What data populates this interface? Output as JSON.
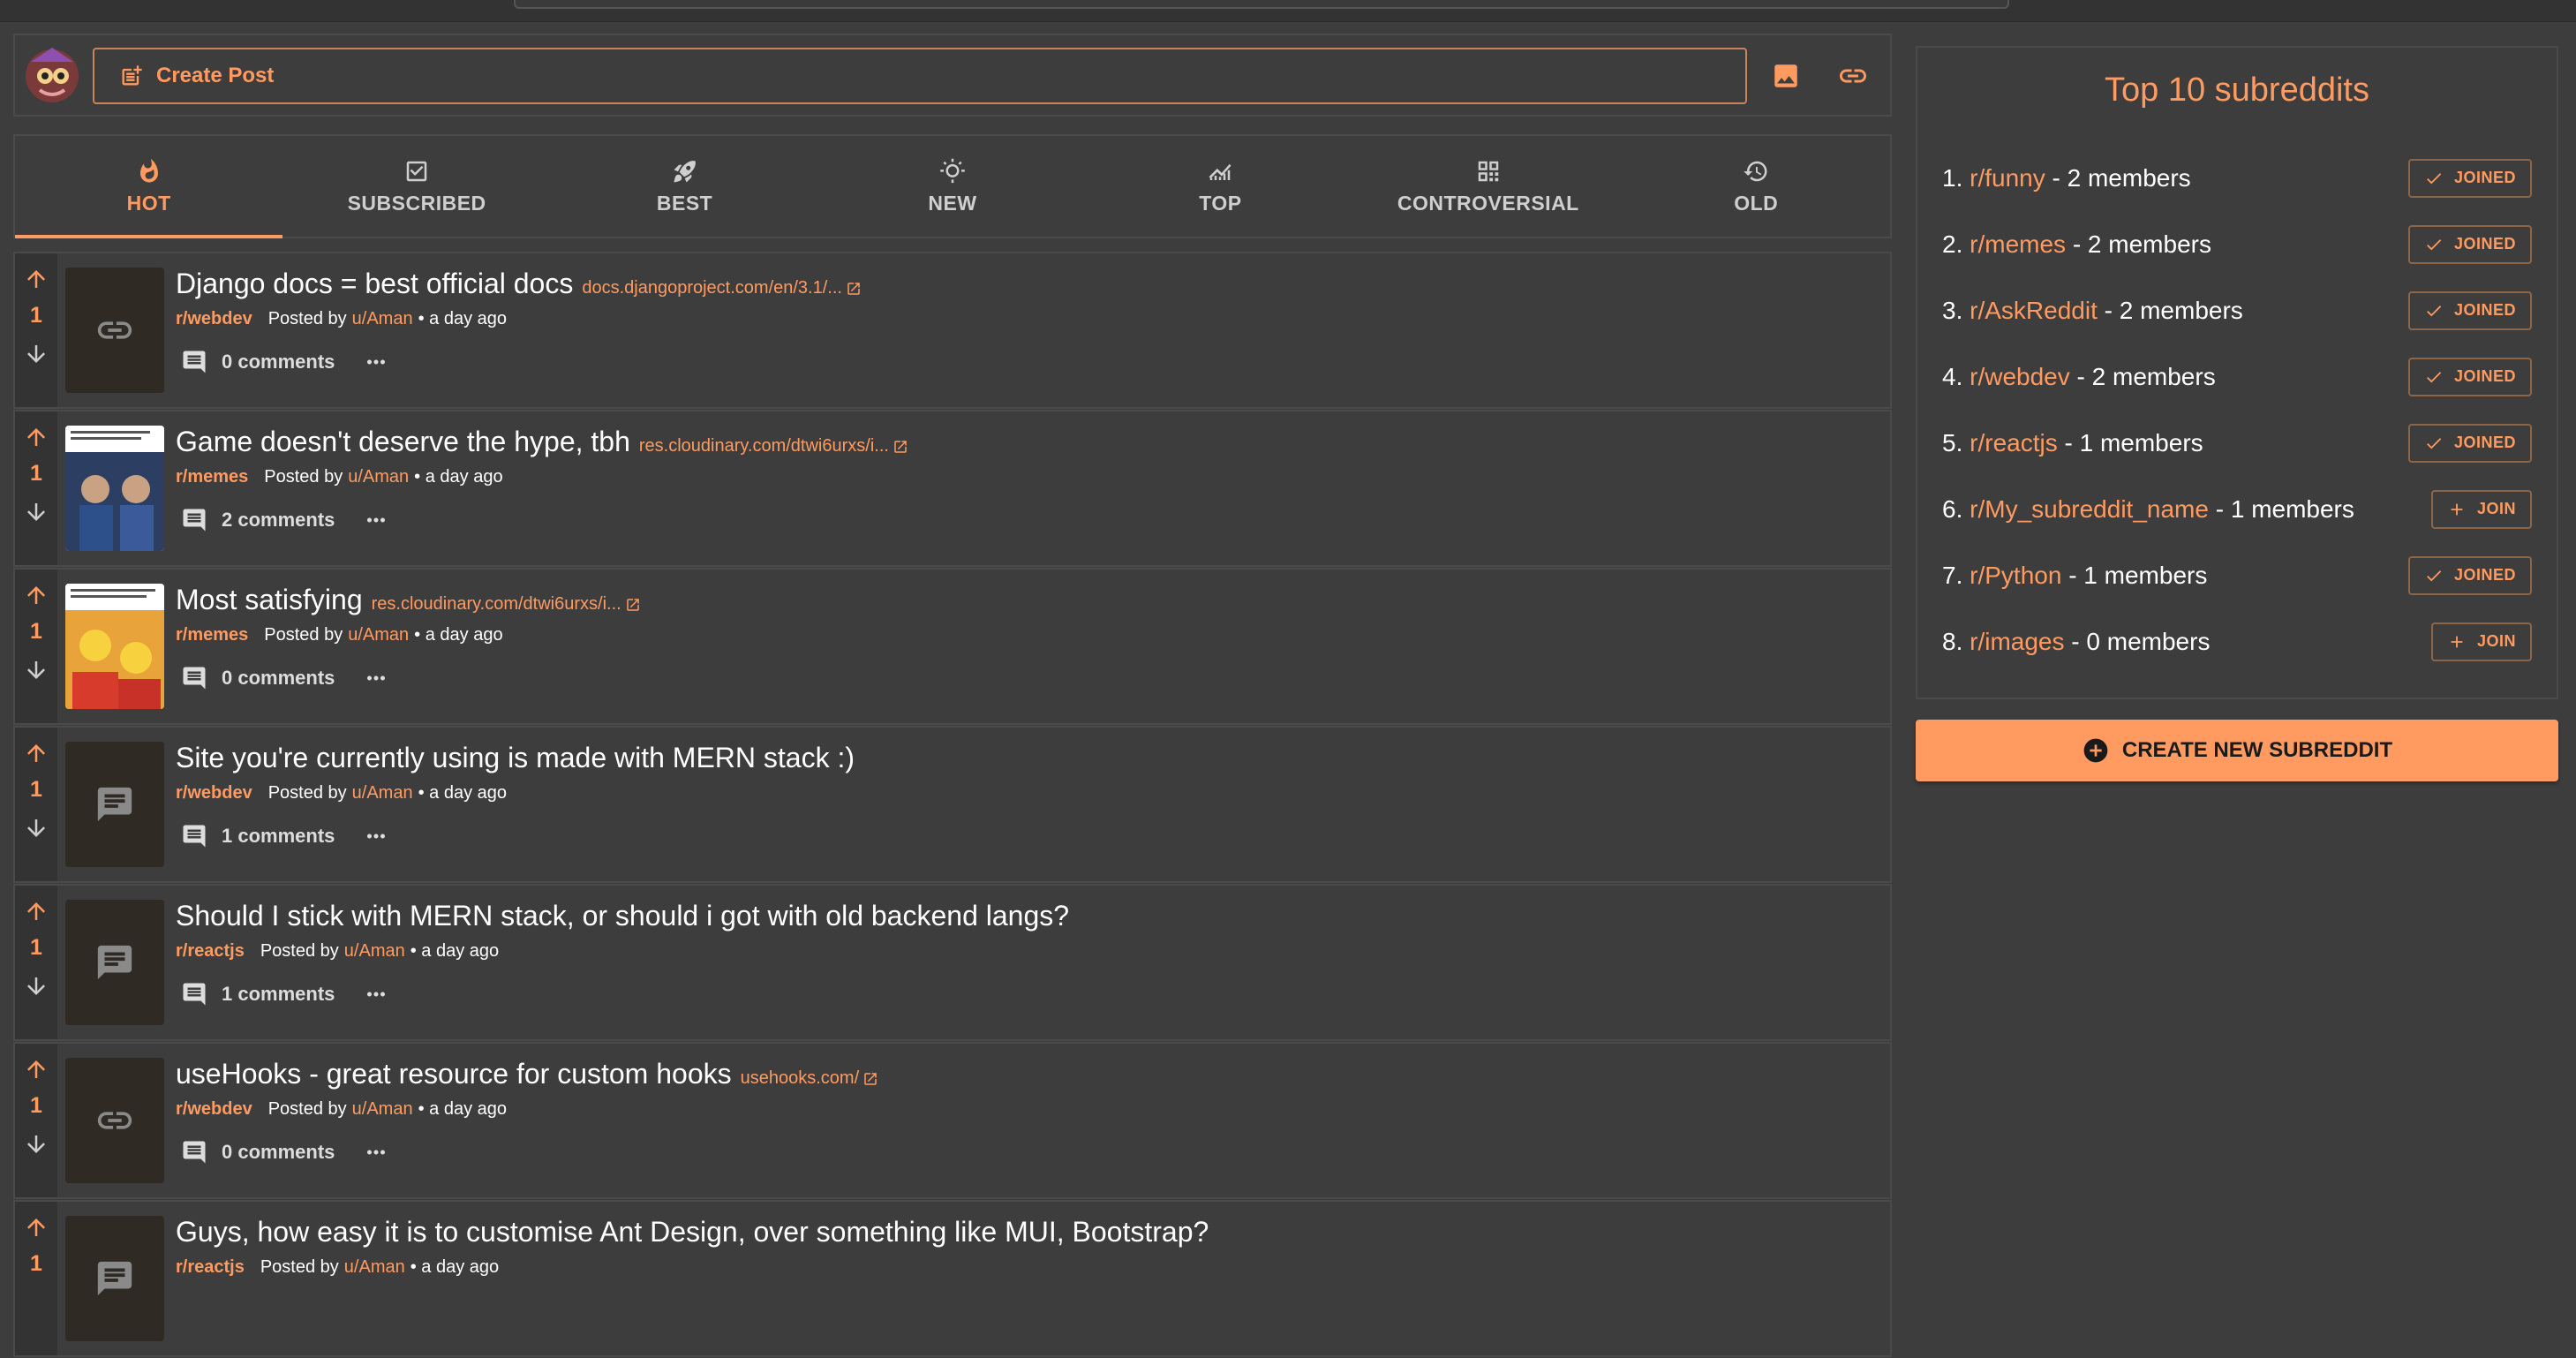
{
  "create_post": {
    "label": "Create Post"
  },
  "tabs": [
    {
      "label": "HOT",
      "icon": "flame-icon"
    },
    {
      "label": "SUBSCRIBED",
      "icon": "check-box-icon"
    },
    {
      "label": "BEST",
      "icon": "rocket-icon"
    },
    {
      "label": "NEW",
      "icon": "sunrise-icon"
    },
    {
      "label": "TOP",
      "icon": "trending-icon"
    },
    {
      "label": "CONTROVERSIAL",
      "icon": "people-icon"
    },
    {
      "label": "OLD",
      "icon": "history-icon"
    }
  ],
  "posts": [
    {
      "score": "1",
      "title": "Django docs = best official docs",
      "link": "docs.djangoproject.com/en/3.1/...",
      "subreddit": "r/webdev",
      "posted_by": "Posted by",
      "user": "u/Aman",
      "time": "• a day ago",
      "comments": "0 comments",
      "thumb": "link"
    },
    {
      "score": "1",
      "title": "Game doesn't deserve the hype, tbh",
      "link": "res.cloudinary.com/dtwi6urxs/i...",
      "subreddit": "r/memes",
      "posted_by": "Posted by",
      "user": "u/Aman",
      "time": "• a day ago",
      "comments": "2 comments",
      "thumb": "image"
    },
    {
      "score": "1",
      "title": "Most satisfying",
      "link": "res.cloudinary.com/dtwi6urxs/i...",
      "subreddit": "r/memes",
      "posted_by": "Posted by",
      "user": "u/Aman",
      "time": "• a day ago",
      "comments": "0 comments",
      "thumb": "image2"
    },
    {
      "score": "1",
      "title": "Site you're currently using is made with MERN stack :)",
      "link": "",
      "subreddit": "r/webdev",
      "posted_by": "Posted by",
      "user": "u/Aman",
      "time": "• a day ago",
      "comments": "1 comments",
      "thumb": "text"
    },
    {
      "score": "1",
      "title": "Should I stick with MERN stack, or should i got with old backend langs?",
      "link": "",
      "subreddit": "r/reactjs",
      "posted_by": "Posted by",
      "user": "u/Aman",
      "time": "• a day ago",
      "comments": "1 comments",
      "thumb": "text"
    },
    {
      "score": "1",
      "title": "useHooks - great resource for custom hooks",
      "link": "usehooks.com/",
      "subreddit": "r/webdev",
      "posted_by": "Posted by",
      "user": "u/Aman",
      "time": "• a day ago",
      "comments": "0 comments",
      "thumb": "link"
    },
    {
      "score": "1",
      "title": "Guys, how easy it is to customise Ant Design, over something like MUI, Bootstrap?",
      "link": "",
      "subreddit": "r/reactjs",
      "posted_by": "Posted by",
      "user": "u/Aman",
      "time": "• a day ago",
      "comments": "",
      "thumb": "text"
    }
  ],
  "sidebar": {
    "title": "Top 10 subreddits",
    "items": [
      {
        "rank": "1.",
        "name": "r/funny",
        "members": " - 2 members",
        "button": "JOINED",
        "joined": true
      },
      {
        "rank": "2.",
        "name": "r/memes",
        "members": " - 2 members",
        "button": "JOINED",
        "joined": true
      },
      {
        "rank": "3.",
        "name": "r/AskReddit",
        "members": " - 2 members",
        "button": "JOINED",
        "joined": true
      },
      {
        "rank": "4.",
        "name": "r/webdev",
        "members": " - 2 members",
        "button": "JOINED",
        "joined": true
      },
      {
        "rank": "5.",
        "name": "r/reactjs",
        "members": " - 1 members",
        "button": "JOINED",
        "joined": true
      },
      {
        "rank": "6.",
        "name": "r/My_subreddit_name",
        "members": " - 1 members",
        "button": "JOIN",
        "joined": false
      },
      {
        "rank": "7.",
        "name": "r/Python",
        "members": " - 1 members",
        "button": "JOINED",
        "joined": true
      },
      {
        "rank": "8.",
        "name": "r/images",
        "members": " - 0 members",
        "button": "JOIN",
        "joined": false
      }
    ],
    "create_label": "CREATE NEW SUBREDDIT"
  },
  "colors": {
    "accent": "#ff9b60",
    "background": "#3d3d3d"
  }
}
